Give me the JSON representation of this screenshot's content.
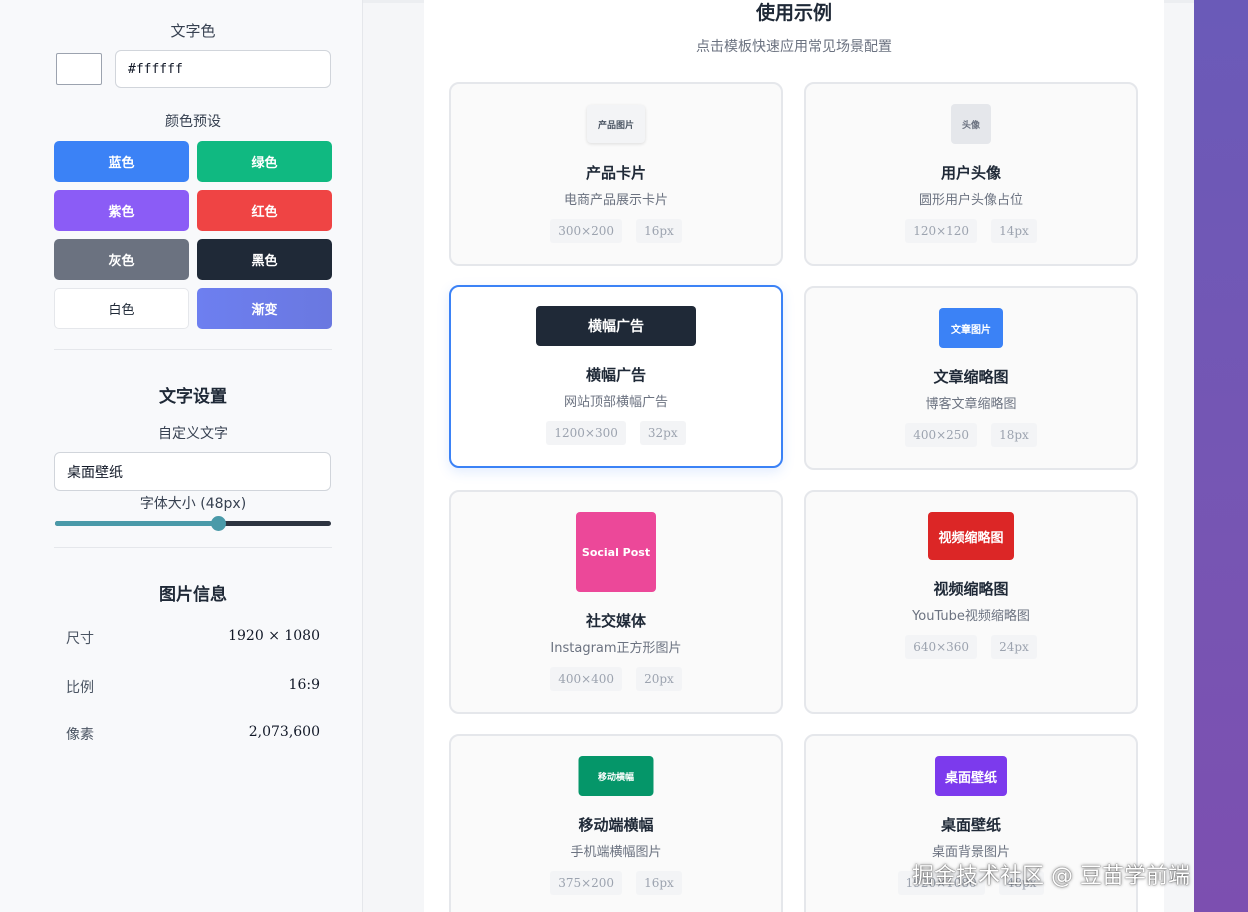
{
  "sidebar": {
    "text_color": {
      "label": "文字色",
      "swatch_color": "#ffffff",
      "value": "#ffffff"
    },
    "presets": {
      "label": "颜色预设",
      "items": [
        {
          "label": "蓝色",
          "color": "#3b82f6"
        },
        {
          "label": "绿色",
          "color": "#10b981"
        },
        {
          "label": "紫色",
          "color": "#8b5cf6"
        },
        {
          "label": "红色",
          "color": "#ef4444"
        },
        {
          "label": "灰色",
          "color": "#6b7280"
        },
        {
          "label": "黑色",
          "color": "#1f2937"
        },
        {
          "label": "白色",
          "color": "#ffffff"
        },
        {
          "label": "渐变",
          "color": "#6b7ce8"
        }
      ]
    },
    "text_settings": {
      "title": "文字设置",
      "custom_text_label": "自定义文字",
      "custom_text_value": "桌面壁纸",
      "font_size_label": "字体大小 (48px)",
      "font_size_fraction": 0.59
    },
    "image_info": {
      "title": "图片信息",
      "rows": [
        {
          "key": "尺寸",
          "value": "1920 × 1080"
        },
        {
          "key": "比例",
          "value": "16:9"
        },
        {
          "key": "像素",
          "value": "2,073,600"
        }
      ]
    }
  },
  "main": {
    "title": "使用示例",
    "subtitle": "点击模板快速应用常见场景配置",
    "cards": [
      {
        "title": "产品卡片",
        "desc": "电商产品展示卡片",
        "size": "300×200",
        "font": "16px",
        "thumb_text": "产品图片",
        "thumb_bg": "#f3f4f6",
        "thumb_fg": "#4b5563",
        "active": false
      },
      {
        "title": "用户头像",
        "desc": "圆形用户头像占位",
        "size": "120×120",
        "font": "14px",
        "thumb_text": "头像",
        "thumb_bg": "#e5e7eb",
        "thumb_fg": "#6b7280",
        "active": false
      },
      {
        "title": "横幅广告",
        "desc": "网站顶部横幅广告",
        "size": "1200×300",
        "font": "32px",
        "thumb_text": "横幅广告",
        "thumb_bg": "#1f2937",
        "thumb_fg": "#ffffff",
        "active": true
      },
      {
        "title": "文章缩略图",
        "desc": "博客文章缩略图",
        "size": "400×250",
        "font": "18px",
        "thumb_text": "文章图片",
        "thumb_bg": "#3b82f6",
        "thumb_fg": "#ffffff",
        "active": false
      },
      {
        "title": "社交媒体",
        "desc": "Instagram正方形图片",
        "size": "400×400",
        "font": "20px",
        "thumb_text": "Social Post",
        "thumb_bg": "#ec4899",
        "thumb_fg": "#ffffff",
        "active": false
      },
      {
        "title": "视频缩略图",
        "desc": "YouTube视频缩略图",
        "size": "640×360",
        "font": "24px",
        "thumb_text": "视频缩略图",
        "thumb_bg": "#dc2626",
        "thumb_fg": "#ffffff",
        "active": false
      },
      {
        "title": "移动端横幅",
        "desc": "手机端横幅图片",
        "size": "375×200",
        "font": "16px",
        "thumb_text": "移动横幅",
        "thumb_bg": "#059669",
        "thumb_fg": "#ffffff",
        "active": false
      },
      {
        "title": "桌面壁纸",
        "desc": "桌面背景图片",
        "size": "1920×1080",
        "font": "48px",
        "thumb_text": "桌面壁纸",
        "thumb_bg": "#7c3aed",
        "thumb_fg": "#ffffff",
        "active": false
      }
    ]
  },
  "watermark": "掘金技术社区 @ 豆苗学前端"
}
